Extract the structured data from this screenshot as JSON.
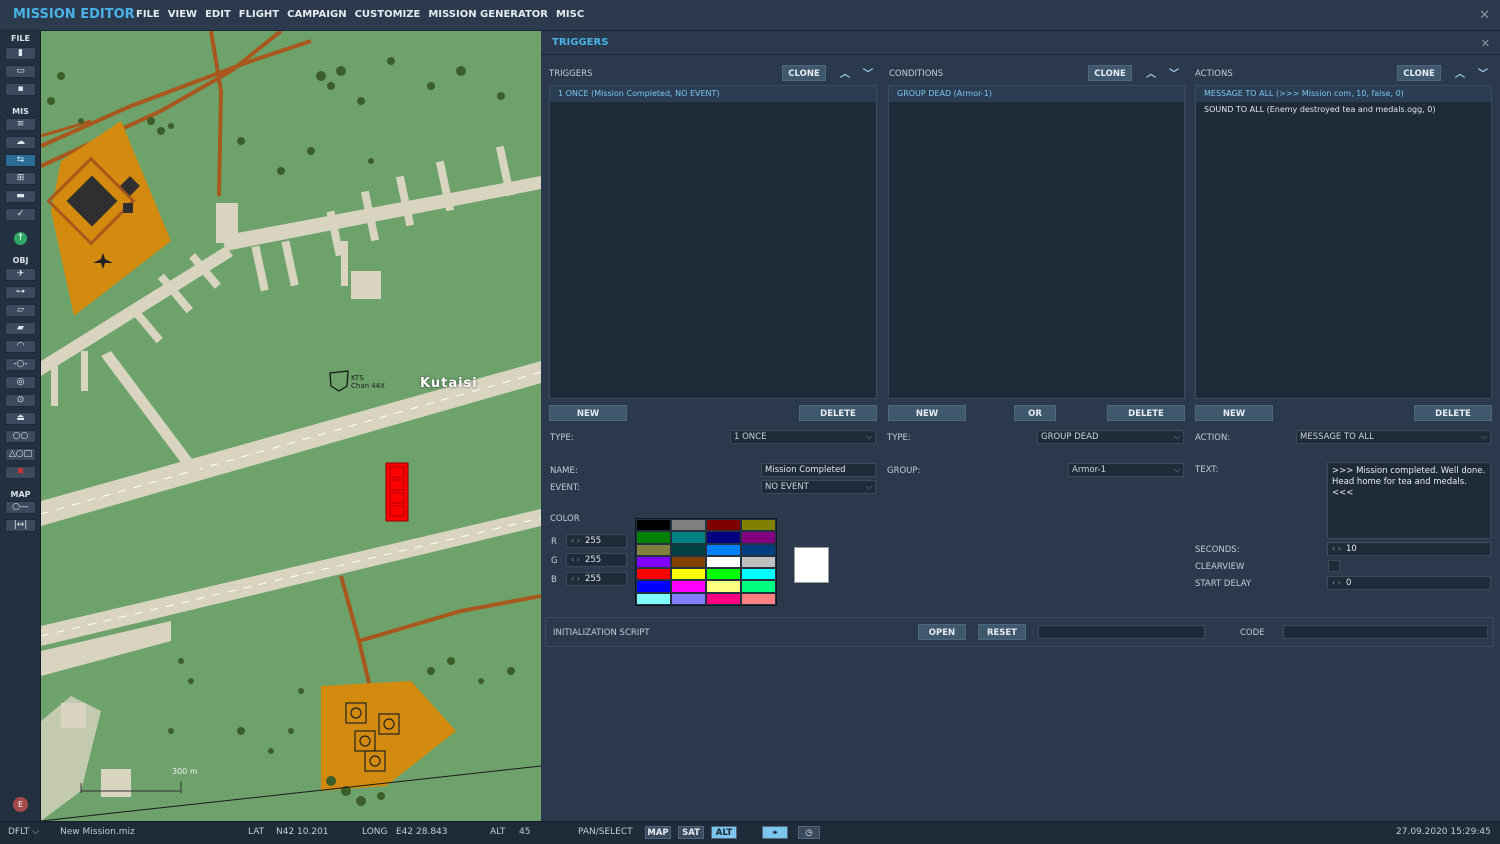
{
  "app": {
    "title": "MISSION EDITOR",
    "menu": [
      "FILE",
      "VIEW",
      "EDIT",
      "FLIGHT",
      "CAMPAIGN",
      "CUSTOMIZE",
      "MISSION GENERATOR",
      "MISC"
    ]
  },
  "sidebar": {
    "file_label": "FILE",
    "mis_label": "MIS",
    "obj_label": "OBJ",
    "map_label": "MAP"
  },
  "map": {
    "city_label": "Kutaisi",
    "navaid_line1": "KTS",
    "navaid_line2": "Chan 44X",
    "scale_label": "300 m"
  },
  "triggers_panel": {
    "title": "TRIGGERS",
    "triggers": {
      "header": "TRIGGERS",
      "clone": "CLONE",
      "items": [
        "1 ONCE (Mission Completed, NO EVENT)"
      ],
      "new": "NEW",
      "delete": "DELETE",
      "type_label": "TYPE:",
      "type_value": "1 ONCE",
      "name_label": "NAME:",
      "name_value": "Mission Completed",
      "event_label": "EVENT:",
      "event_value": "NO EVENT"
    },
    "conditions": {
      "header": "CONDITIONS",
      "clone": "CLONE",
      "items": [
        "GROUP DEAD (Armor-1)"
      ],
      "new": "NEW",
      "or": "OR",
      "delete": "DELETE",
      "type_label": "TYPE:",
      "type_value": "GROUP DEAD",
      "group_label": "GROUP:",
      "group_value": "Armor-1"
    },
    "actions": {
      "header": "ACTIONS",
      "clone": "CLONE",
      "items": [
        "MESSAGE TO ALL (>>> Mission com, 10, false, 0)",
        "SOUND TO ALL (Enemy destroyed tea and medals.ogg, 0)"
      ],
      "new": "NEW",
      "delete": "DELETE",
      "action_label": "ACTION:",
      "action_value": "MESSAGE TO ALL",
      "text_label": "TEXT:",
      "text_value": ">>> Mission completed. Well done. Head home for tea and medals.\n<<<",
      "seconds_label": "SECONDS:",
      "seconds_value": "10",
      "clearview_label": "CLEARVIEW",
      "start_delay_label": "START DELAY",
      "start_delay_value": "0"
    },
    "color": {
      "label": "COLOR",
      "r_label": "R",
      "g_label": "G",
      "b_label": "B",
      "r": "255",
      "g": "255",
      "b": "255",
      "preview": "#ffffff",
      "palette": [
        "#000000",
        "#808080",
        "#800000",
        "#808000",
        "#008000",
        "#008080",
        "#000080",
        "#800080",
        "#808040",
        "#004040",
        "#0080ff",
        "#004080",
        "#8000ff",
        "#804000",
        "#ffffff",
        "#c0c0c0",
        "#ff0000",
        "#ffff00",
        "#00ff00",
        "#00ffff",
        "#0000ff",
        "#ff00ff",
        "#ffff80",
        "#00ff80",
        "#80ffff",
        "#8080ff",
        "#ff0080",
        "#ff8080"
      ]
    },
    "init": {
      "label": "INITIALIZATION SCRIPT",
      "open": "OPEN",
      "reset": "RESET",
      "code_label": "CODE"
    }
  },
  "statusbar": {
    "profile": "DFLT",
    "file": "New Mission.miz",
    "lat_label": "LAT",
    "lat": "N42 10.201",
    "long_label": "LONG",
    "long": "E42 28.843",
    "alt_label": "ALT",
    "alt": "45",
    "pan": "PAN/SELECT",
    "map": "MAP",
    "sat": "SAT",
    "altbtn": "ALT",
    "datetime": "27.09.2020 15:29:45"
  }
}
